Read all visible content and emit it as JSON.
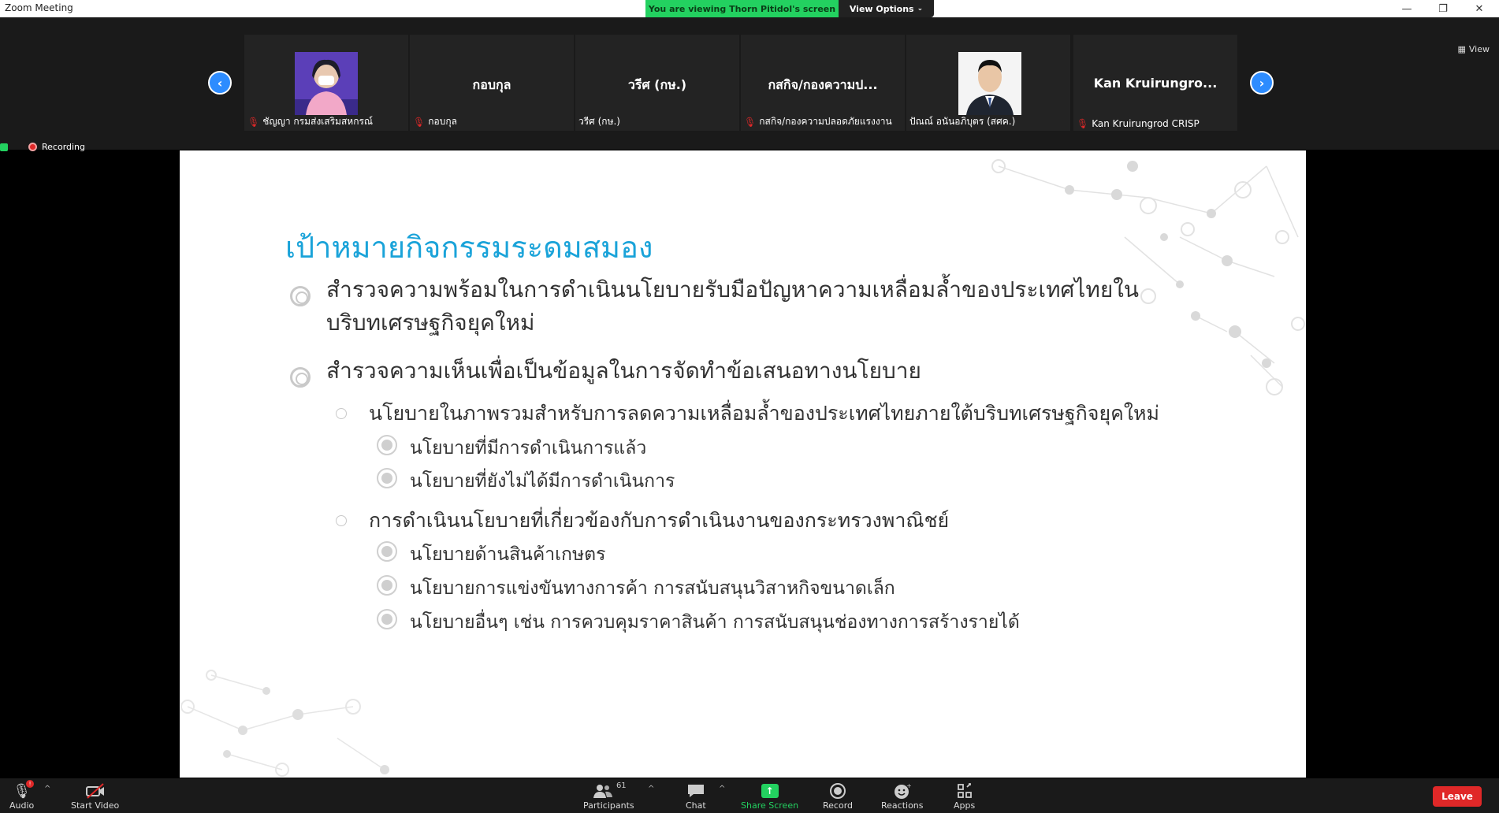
{
  "window": {
    "title": "Zoom Meeting",
    "viewing_banner": "You are viewing Thorn Pitidol's screen",
    "view_options": "View Options",
    "view_button": "View"
  },
  "recording": {
    "label": "Recording"
  },
  "participants_strip": [
    {
      "caption": "ชัญญา  กรมส่งเสริมสหกรณ์",
      "big_name": "",
      "has_video": true,
      "muted": true
    },
    {
      "caption": "กอบกุล",
      "big_name": "กอบกุล",
      "has_video": false,
      "muted": true
    },
    {
      "caption": "วรีศ (กษ.)",
      "big_name": "วรีศ (กษ.)",
      "has_video": false,
      "muted": false
    },
    {
      "caption": "กสกิจ/กองความปลอดภัยแรงงาน",
      "big_name": "กสกิจ/กองความป...",
      "has_video": false,
      "muted": true
    },
    {
      "caption": "ปัณณ์ อนันอภิบุตร (สศค.)",
      "big_name": "",
      "has_video": true,
      "muted": false
    },
    {
      "caption": "Kan Kruirungrod CRISP",
      "big_name": "Kan  Kruirungro...",
      "has_video": false,
      "muted": true
    }
  ],
  "slide": {
    "title": "เป้าหมายกิจกรรมระดมสมอง",
    "bullets": [
      {
        "level": 1,
        "line1": "สำรวจความพร้อมในการดำเนินนโยบายรับมือปัญหาความเหลื่อมล้ำของประเทศไทยใน",
        "line2": "บริบทเศรษฐกิจยุคใหม่"
      },
      {
        "level": 1,
        "line1": "สำรวจความเห็นเพื่อเป็นข้อมูลในการจัดทำข้อเสนอทางนโยบาย",
        "line2": ""
      },
      {
        "level": 2,
        "text": "นโยบายในภาพรวมสำหรับการลดความเหลื่อมล้ำของประเทศไทยภายใต้บริบทเศรษฐกิจยุคใหม่"
      },
      {
        "level": 3,
        "text": "นโยบายที่มีการดำเนินการแล้ว"
      },
      {
        "level": 3,
        "text": "นโยบายที่ยังไม่ได้มีการดำเนินการ"
      },
      {
        "level": 2,
        "text": "การดำเนินนโยบายที่เกี่ยวข้องกับการดำเนินงานของกระทรวงพาณิชย์"
      },
      {
        "level": 3,
        "text": "นโยบายด้านสินค้าเกษตร"
      },
      {
        "level": 3,
        "text": "นโยบายการแข่งขันทางการค้า การสนับสนุนวิสาหกิจขนาดเล็ก"
      },
      {
        "level": 3,
        "text": "นโยบายอื่นๆ เช่น การควบคุมราคาสินค้า การสนับสนุนช่องทางการสร้างรายได้"
      }
    ]
  },
  "toolbar": {
    "audio": "Audio",
    "start_video": "Start Video",
    "participants": "Participants",
    "participant_count": "61",
    "chat": "Chat",
    "share_screen": "Share Screen",
    "record": "Record",
    "reactions": "Reactions",
    "apps": "Apps",
    "leave": "Leave"
  },
  "colors": {
    "accent_blue": "#2d8cff",
    "title_blue": "#1aa3d9",
    "share_green": "#23d160",
    "leave_red": "#e02828"
  }
}
